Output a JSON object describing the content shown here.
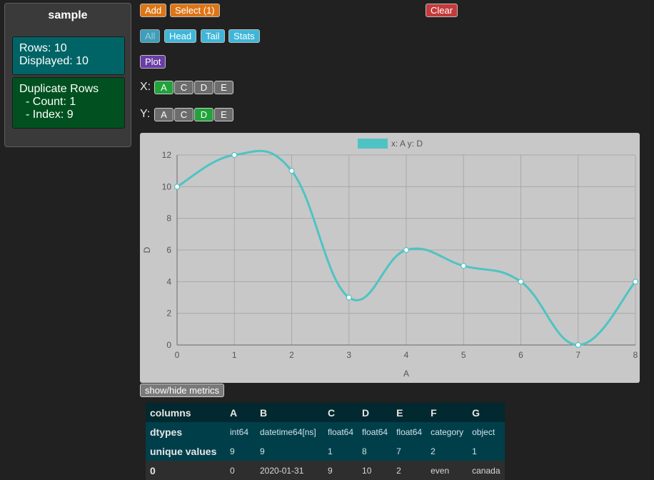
{
  "sidebar": {
    "title": "sample",
    "rows": "Rows: 10",
    "displayed": "Displayed: 10",
    "dup_title": "Duplicate Rows",
    "dup_count": "- Count: 1",
    "dup_index": "- Index: 9"
  },
  "toolbar": {
    "add": "Add",
    "select": "Select (1)",
    "clear": "Clear",
    "all": "All",
    "head": "Head",
    "tail": "Tail",
    "stats": "Stats",
    "plot": "Plot"
  },
  "axis_select": {
    "x_label": "X:",
    "y_label": "Y:",
    "x_options": [
      "A",
      "C",
      "D",
      "E"
    ],
    "y_options": [
      "A",
      "C",
      "D",
      "E"
    ],
    "x_selected": "A",
    "y_selected": "D"
  },
  "chart_data": {
    "type": "line",
    "x": [
      0,
      1,
      2,
      3,
      4,
      5,
      6,
      7,
      8
    ],
    "series": [
      {
        "name": "x: A y: D",
        "values": [
          10,
          12,
          11,
          3,
          6,
          5,
          4,
          0,
          4
        ]
      }
    ],
    "xlabel": "A",
    "ylabel": "D",
    "xlim": [
      0,
      8
    ],
    "ylim": [
      0,
      12
    ],
    "x_ticks": [
      0,
      1,
      2,
      3,
      4,
      5,
      6,
      7,
      8
    ],
    "y_ticks": [
      0,
      2,
      4,
      6,
      8,
      10,
      12
    ],
    "grid": true,
    "legend": "top-center",
    "line_color": "#4fc3c3"
  },
  "metrics_button": "show/hide metrics",
  "table": {
    "header_label": "columns",
    "columns": [
      "A",
      "B",
      "C",
      "D",
      "E",
      "F",
      "G"
    ],
    "dtypes_label": "dtypes",
    "dtypes": [
      "int64",
      "datetime64[ns]",
      "float64",
      "float64",
      "float64",
      "category",
      "object"
    ],
    "unique_label": "unique values",
    "unique": [
      "9",
      "9",
      "1",
      "8",
      "7",
      "2",
      "1"
    ],
    "rows": [
      {
        "index": "0",
        "values": [
          "0",
          "2020-01-31",
          "9",
          "10",
          "2",
          "even",
          "canada"
        ]
      }
    ]
  }
}
